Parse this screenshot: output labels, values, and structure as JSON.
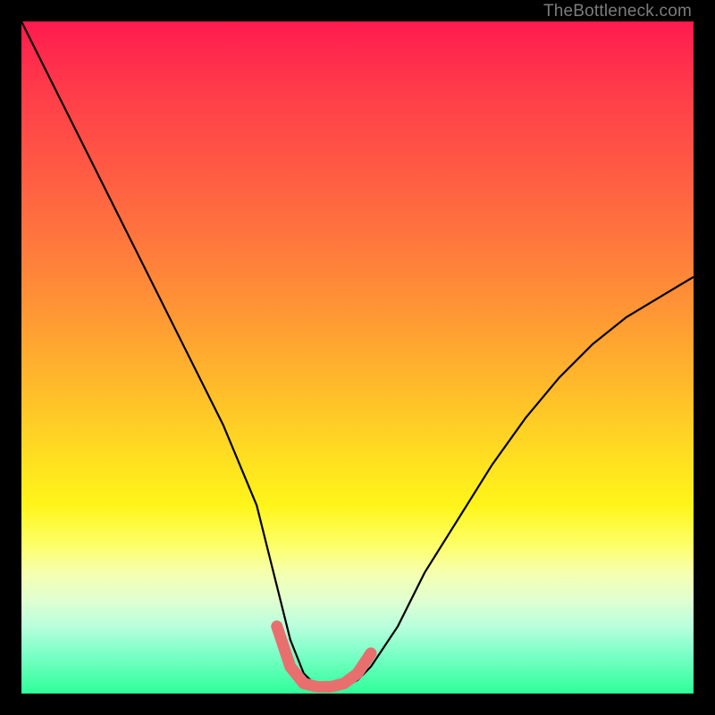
{
  "watermark": "TheBottleneck.com",
  "chart_data": {
    "type": "line",
    "title": "",
    "xlabel": "",
    "ylabel": "",
    "xlim": [
      0,
      100
    ],
    "ylim": [
      0,
      100
    ],
    "series": [
      {
        "name": "bottleneck-curve",
        "x": [
          0,
          5,
          10,
          15,
          20,
          25,
          30,
          35,
          38,
          40,
          42,
          44,
          46,
          48,
          50,
          52,
          56,
          60,
          65,
          70,
          75,
          80,
          85,
          90,
          95,
          100
        ],
        "y": [
          100,
          90,
          80,
          70,
          60,
          50,
          40,
          28,
          16,
          8,
          3,
          1,
          1,
          1,
          2,
          4,
          10,
          18,
          26,
          34,
          41,
          47,
          52,
          56,
          59,
          62
        ]
      },
      {
        "name": "bottleneck-minimum-band",
        "x": [
          38,
          40,
          42,
          44,
          46,
          48,
          50,
          52
        ],
        "y": [
          10,
          4,
          1.5,
          1,
          1,
          1.5,
          3,
          6
        ]
      }
    ],
    "colors": {
      "curve": "#000000",
      "band": "#e96f6f",
      "gradient_top": "#ff1a4f",
      "gradient_bottom": "#2dff99"
    }
  }
}
